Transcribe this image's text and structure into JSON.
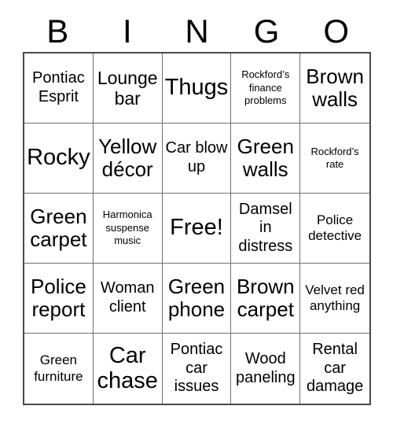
{
  "card": {
    "title": "BINGO",
    "header_letters": [
      "B",
      "I",
      "N",
      "G",
      "O"
    ],
    "rows": 5,
    "columns": 5,
    "colors": {
      "background": "#ffffff",
      "text": "#000000",
      "outer_border": "#4a4a4a",
      "inner_grid_line": "#6f6f6f"
    },
    "cells": [
      {
        "text": "Pontiac Esprit",
        "size": "fs-md",
        "free": false
      },
      {
        "text": "Lounge bar",
        "size": "fs-lg",
        "free": false
      },
      {
        "text": "Thugs",
        "size": "fs-xxl",
        "free": false
      },
      {
        "text": "Rockford’s finance problems",
        "size": "fs-xs",
        "free": false
      },
      {
        "text": "Brown walls",
        "size": "fs-xl",
        "free": false
      },
      {
        "text": "Rocky",
        "size": "fs-xxl",
        "free": false
      },
      {
        "text": "Yellow décor",
        "size": "fs-xl",
        "free": false
      },
      {
        "text": "Car blow up",
        "size": "fs-md",
        "free": false
      },
      {
        "text": "Green walls",
        "size": "fs-xl",
        "free": false
      },
      {
        "text": "Rockford’s rate",
        "size": "fs-xs",
        "free": false
      },
      {
        "text": "Green carpet",
        "size": "fs-xl",
        "free": false
      },
      {
        "text": "Harmonica suspense music",
        "size": "fs-xs",
        "free": false
      },
      {
        "text": "Free!",
        "size": "fs-xxl",
        "free": true
      },
      {
        "text": "Damsel in distress",
        "size": "fs-md",
        "free": false
      },
      {
        "text": "Police detective",
        "size": "fs-sm",
        "free": false
      },
      {
        "text": "Police report",
        "size": "fs-xl",
        "free": false
      },
      {
        "text": "Woman client",
        "size": "fs-md",
        "free": false
      },
      {
        "text": "Green phone",
        "size": "fs-xl",
        "free": false
      },
      {
        "text": "Brown carpet",
        "size": "fs-xl",
        "free": false
      },
      {
        "text": "Velvet red anything",
        "size": "fs-sm",
        "free": false
      },
      {
        "text": "Green furniture",
        "size": "fs-sm",
        "free": false
      },
      {
        "text": "Car chase",
        "size": "fs-xxl",
        "free": false
      },
      {
        "text": "Pontiac car issues",
        "size": "fs-md",
        "free": false
      },
      {
        "text": "Wood paneling",
        "size": "fs-md",
        "free": false
      },
      {
        "text": "Rental car damage",
        "size": "fs-md",
        "free": false
      }
    ]
  }
}
